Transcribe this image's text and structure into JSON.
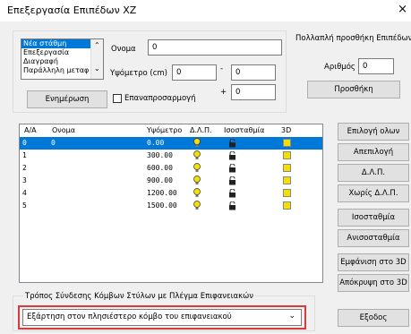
{
  "window": {
    "title": "Επεξεργασία Επιπέδων ΧΖ",
    "close": "×"
  },
  "mode_list": {
    "items": [
      "Νέα στάθμη",
      "Επεξεργασία",
      "Διαγραφή",
      "Παράλληλη μεταφ"
    ],
    "selected_index": 0
  },
  "fields": {
    "name_label": "Ονομα",
    "name_value": "0",
    "height_label": "Υψόμετρο (cm)",
    "height_value": "0",
    "minus_label": "-",
    "minus_value": "0",
    "plus_label": "+",
    "plus_value": "0"
  },
  "update_button": "Ενημέρωση",
  "readjust_checkbox": {
    "label": "Επαναπροσαρμογή",
    "checked": false
  },
  "multi_add": {
    "title": "Πολλαπλή προσθήκη Επιπέδων",
    "count_label": "Αριθμός",
    "count_value": "0",
    "add_button": "Προσθήκη"
  },
  "table": {
    "columns": [
      "Α/Α",
      "Ονομα",
      "Υψόμετρο",
      "Δ.Λ.Π.",
      "Ισοσταθμία",
      "3D"
    ],
    "rows": [
      {
        "aa": "0",
        "name": "0",
        "height": "0.00"
      },
      {
        "aa": "1",
        "name": "",
        "height": "300.00"
      },
      {
        "aa": "2",
        "name": "",
        "height": "600.00"
      },
      {
        "aa": "3",
        "name": "",
        "height": "900.00"
      },
      {
        "aa": "4",
        "name": "",
        "height": "1200.00"
      },
      {
        "aa": "5",
        "name": "",
        "height": "1500.00"
      }
    ],
    "selected_index": 0
  },
  "side_buttons": [
    "Επιλογή ολων",
    "Απεπιλογή",
    "Δ.Λ.Π.",
    "Χωρίς Δ.Λ.Π.",
    "Ισοσταθμία",
    "Ανισοσταθμία",
    "Εμφάνιση στο 3D",
    "Απόκρυψη στο 3D"
  ],
  "connection": {
    "title": "Τρόπος Σύνδεσης Κόμβων Στύλων με Πλέγμα Επιφανειακών",
    "value": "Εξάρτηση στον πλησιέστερο κόμβο του επιφανειακού"
  },
  "exit_button": "Εξοδος",
  "colors": {
    "selection": "#0078d7",
    "highlight_border": "#d53c3c",
    "bulb": "#f4e000"
  }
}
